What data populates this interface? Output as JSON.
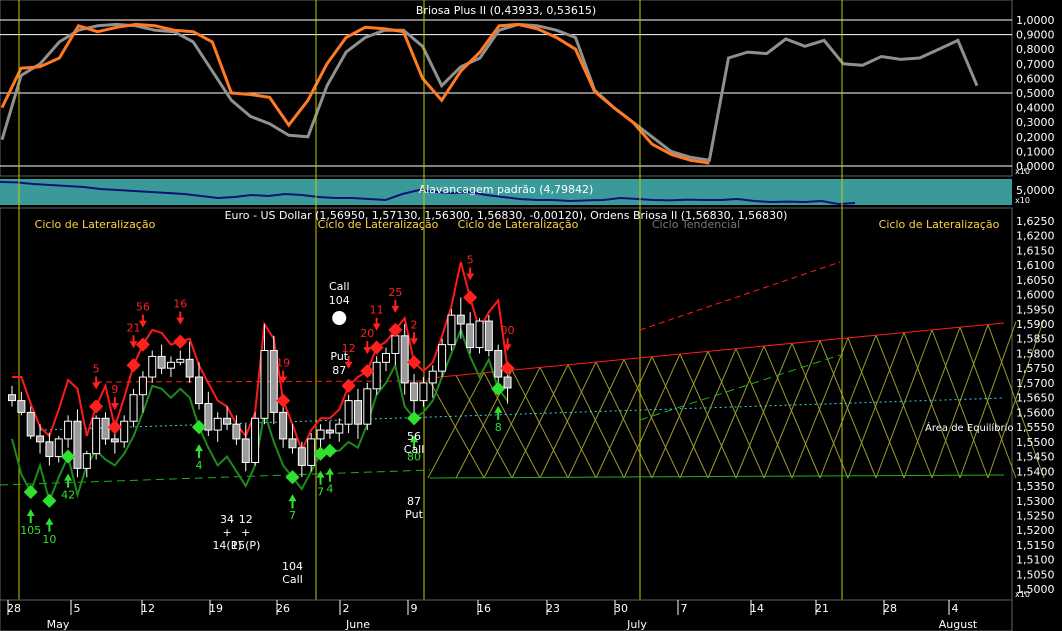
{
  "colors": {
    "background": "#000000",
    "grid": "#ffffff",
    "vline": "#c8c800",
    "band": "#3a9a9a",
    "red": "#ff1a1a",
    "green": "#1e8a1e",
    "orange": "#ff7a22",
    "gray": "#909090",
    "navy": "#10107a",
    "yellow_label": "#ffd24a",
    "cyan": "#30d8e8",
    "lattice": "#9a9a30"
  },
  "icons": {
    "stop_marker": "stop-sign-icon",
    "buy_arrow": "up-arrow-icon",
    "sell_arrow": "down-arrow-icon",
    "signal_diamond": "diamond-icon"
  },
  "panels": {
    "oscillator": {
      "title": "Briosa Plus II (0,43933, 0,53615)",
      "y_ticks": [
        "1,0000",
        "0,9000",
        "0,8000",
        "0,7000",
        "0,6000",
        "0,5000",
        "0,4000",
        "0,3000",
        "0,2000",
        "0,1000",
        "0,0000"
      ],
      "x10": "x10"
    },
    "leverage": {
      "title": "Alavancagem padrão (4,79842)",
      "y_ticks": [
        "5,0000"
      ],
      "x10": "x10"
    },
    "price": {
      "title": "Euro - US Dollar (1,56950, 1,57130, 1,56300, 1,56830, -0,00120), Ordens Briosa II (1,56830, 1,56830)",
      "y_ticks": [
        "1,6250",
        "1,6200",
        "1,6150",
        "1,6100",
        "1,6050",
        "1,6000",
        "1,5950",
        "1,5900",
        "1,5850",
        "1,5800",
        "1,5750",
        "1,5700",
        "1,5650",
        "1,5600",
        "1,5550",
        "1,5500",
        "1,5450",
        "1,5400",
        "1,5350",
        "1,5300",
        "1,5250",
        "1,5200",
        "1,5150",
        "1,5100",
        "1,5050",
        "1,5000"
      ],
      "x10": "x10",
      "cycle_labels": [
        "Ciclo de Lateralização",
        "Ciclo de Lateralização",
        "Ciclo de Lateralização",
        "Ciclo Tendencial",
        "Ciclo de Lateralização"
      ],
      "equilibrium_label": "Área de Equilíbrio"
    }
  },
  "x_axis": {
    "day_labels": [
      "28",
      "5",
      "12",
      "19",
      "26",
      "2",
      "9",
      "16",
      "23",
      "30",
      "7",
      "14",
      "21",
      "28",
      "4"
    ],
    "month_labels": [
      "May",
      "June",
      "July",
      "August"
    ]
  },
  "chart_data": {
    "type": "candlestick",
    "title": "Euro - US Dollar (1,56950, 1,57130, 1,56300, 1,56830, -0,00120), Ordens Briosa II (1,56830, 1,56830)",
    "ylim": [
      1.497,
      1.627
    ],
    "series": [
      {
        "name": "Briosa Plus II",
        "kind": "oscillator",
        "ylim": [
          0,
          1.05
        ],
        "values_gray": [
          0.18,
          0.62,
          0.7,
          0.85,
          0.93,
          0.96,
          0.97,
          0.96,
          0.93,
          0.92,
          0.85,
          0.65,
          0.45,
          0.34,
          0.29,
          0.21,
          0.2,
          0.55,
          0.78,
          0.88,
          0.93,
          0.93,
          0.82,
          0.55,
          0.68,
          0.74,
          0.93,
          0.97,
          0.96,
          0.93,
          0.88,
          0.52,
          0.4,
          0.3,
          0.2,
          0.1,
          0.06,
          0.04,
          0.74,
          0.78,
          0.77,
          0.87,
          0.82,
          0.86,
          0.7,
          0.69,
          0.75,
          0.73,
          0.74,
          0.8,
          0.86,
          0.55
        ],
        "values_orange": [
          0.4,
          0.67,
          0.68,
          0.74,
          0.96,
          0.92,
          0.95,
          0.97,
          0.96,
          0.93,
          0.92,
          0.85,
          0.5,
          0.49,
          0.47,
          0.28,
          0.45,
          0.7,
          0.88,
          0.95,
          0.94,
          0.92,
          0.6,
          0.45,
          0.65,
          0.78,
          0.96,
          0.97,
          0.94,
          0.88,
          0.8,
          0.51,
          0.4,
          0.3,
          0.15,
          0.08,
          0.04,
          0.02
        ]
      },
      {
        "name": "Alavancagem padrão",
        "kind": "leverage",
        "values": [
          4.8,
          4.78,
          4.7,
          4.65,
          4.6,
          4.55,
          4.45,
          4.4,
          4.35,
          4.3,
          4.25,
          4.2,
          4.1,
          4.0,
          4.05,
          4.15,
          4.1,
          4.2,
          4.15,
          4.05,
          4.0,
          4.0,
          3.95,
          3.9,
          4.2,
          4.4,
          4.3,
          4.25,
          4.3,
          4.15,
          4.05,
          3.95,
          3.9,
          3.9,
          3.85,
          3.88,
          3.9,
          4.0,
          3.95,
          3.9,
          3.88,
          3.92,
          3.9,
          3.9,
          3.95,
          3.85,
          3.8,
          3.82,
          3.8,
          3.85,
          3.7,
          3.75
        ]
      },
      {
        "name": "Euro - US Dollar",
        "candles": [
          [
            1.566,
            1.569,
            1.562,
            1.564
          ],
          [
            1.564,
            1.567,
            1.559,
            1.56
          ],
          [
            1.56,
            1.562,
            1.551,
            1.552
          ],
          [
            1.552,
            1.556,
            1.546,
            1.55
          ],
          [
            1.55,
            1.553,
            1.542,
            1.545
          ],
          [
            1.545,
            1.552,
            1.543,
            1.551
          ],
          [
            1.551,
            1.559,
            1.548,
            1.557
          ],
          [
            1.557,
            1.561,
            1.538,
            1.541
          ],
          [
            1.541,
            1.547,
            1.538,
            1.546
          ],
          [
            1.546,
            1.559,
            1.544,
            1.558
          ],
          [
            1.558,
            1.56,
            1.549,
            1.551
          ],
          [
            1.551,
            1.553,
            1.546,
            1.55
          ],
          [
            1.55,
            1.559,
            1.548,
            1.557
          ],
          [
            1.557,
            1.568,
            1.555,
            1.566
          ],
          [
            1.566,
            1.574,
            1.56,
            1.572
          ],
          [
            1.572,
            1.581,
            1.57,
            1.579
          ],
          [
            1.579,
            1.583,
            1.573,
            1.575
          ],
          [
            1.575,
            1.579,
            1.572,
            1.577
          ],
          [
            1.577,
            1.581,
            1.576,
            1.578
          ],
          [
            1.578,
            1.584,
            1.57,
            1.572
          ],
          [
            1.572,
            1.577,
            1.561,
            1.563
          ],
          [
            1.563,
            1.567,
            1.552,
            1.554
          ],
          [
            1.554,
            1.56,
            1.55,
            1.558
          ],
          [
            1.558,
            1.562,
            1.554,
            1.556
          ],
          [
            1.556,
            1.559,
            1.549,
            1.551
          ],
          [
            1.551,
            1.556,
            1.54,
            1.543
          ],
          [
            1.543,
            1.56,
            1.542,
            1.558
          ],
          [
            1.558,
            1.59,
            1.556,
            1.581
          ],
          [
            1.581,
            1.586,
            1.556,
            1.56
          ],
          [
            1.56,
            1.564,
            1.548,
            1.551
          ],
          [
            1.551,
            1.556,
            1.546,
            1.548
          ],
          [
            1.548,
            1.55,
            1.538,
            1.542
          ],
          [
            1.542,
            1.553,
            1.54,
            1.551
          ],
          [
            1.551,
            1.556,
            1.548,
            1.554
          ],
          [
            1.554,
            1.557,
            1.551,
            1.553
          ],
          [
            1.553,
            1.558,
            1.55,
            1.556
          ],
          [
            1.556,
            1.566,
            1.553,
            1.564
          ],
          [
            1.564,
            1.568,
            1.551,
            1.556
          ],
          [
            1.556,
            1.57,
            1.554,
            1.568
          ],
          [
            1.568,
            1.579,
            1.566,
            1.577
          ],
          [
            1.577,
            1.582,
            1.574,
            1.58
          ],
          [
            1.58,
            1.588,
            1.576,
            1.586
          ],
          [
            1.586,
            1.59,
            1.566,
            1.57
          ],
          [
            1.57,
            1.573,
            1.56,
            1.564
          ],
          [
            1.564,
            1.572,
            1.562,
            1.57
          ],
          [
            1.57,
            1.576,
            1.565,
            1.574
          ],
          [
            1.574,
            1.585,
            1.572,
            1.583
          ],
          [
            1.583,
            1.595,
            1.581,
            1.593
          ],
          [
            1.593,
            1.599,
            1.585,
            1.59
          ],
          [
            1.59,
            1.594,
            1.58,
            1.582
          ],
          [
            1.582,
            1.592,
            1.58,
            1.591
          ],
          [
            1.591,
            1.593,
            1.579,
            1.581
          ],
          [
            1.581,
            1.583,
            1.57,
            1.572
          ],
          [
            1.572,
            1.575,
            1.563,
            1.5683
          ]
        ],
        "upper_band_red": [
          1.572,
          1.572,
          1.563,
          1.555,
          1.552,
          1.561,
          1.571,
          1.568,
          1.552,
          1.562,
          1.569,
          1.555,
          1.565,
          1.576,
          1.583,
          1.588,
          1.587,
          1.583,
          1.584,
          1.585,
          1.576,
          1.57,
          1.564,
          1.562,
          1.556,
          1.552,
          1.56,
          1.59,
          1.585,
          1.564,
          1.556,
          1.547,
          1.554,
          1.558,
          1.558,
          1.561,
          1.569,
          1.572,
          1.574,
          1.582,
          1.584,
          1.588,
          1.592,
          1.577,
          1.574,
          1.577,
          1.586,
          1.596,
          1.611,
          1.599,
          1.588,
          1.594,
          1.598,
          1.575
        ],
        "lower_band_green": [
          1.551,
          1.539,
          1.533,
          1.542,
          1.53,
          1.538,
          1.545,
          1.532,
          1.542,
          1.547,
          1.544,
          1.542,
          1.546,
          1.552,
          1.56,
          1.569,
          1.568,
          1.565,
          1.568,
          1.565,
          1.555,
          1.548,
          1.542,
          1.545,
          1.54,
          1.535,
          1.542,
          1.56,
          1.55,
          1.542,
          1.538,
          1.534,
          1.54,
          1.546,
          1.547,
          1.547,
          1.55,
          1.548,
          1.556,
          1.566,
          1.57,
          1.576,
          1.562,
          1.558,
          1.56,
          1.564,
          1.572,
          1.58,
          1.588,
          1.579,
          1.572,
          1.578,
          1.568,
          1.564
        ],
        "signals": [
          {
            "i": 9,
            "label": "5",
            "dir": "sell"
          },
          {
            "i": 11,
            "label": "9",
            "dir": "sell"
          },
          {
            "i": 13,
            "label": "21",
            "dir": "sell"
          },
          {
            "i": 14,
            "label": "56",
            "dir": "sell"
          },
          {
            "i": 18,
            "label": "16",
            "dir": "sell"
          },
          {
            "i": 29,
            "label": "19",
            "dir": "sell"
          },
          {
            "i": 36,
            "label": "12",
            "dir": "sell"
          },
          {
            "i": 38,
            "label": "20",
            "dir": "sell"
          },
          {
            "i": 39,
            "label": "11",
            "dir": "sell"
          },
          {
            "i": 41,
            "label": "25",
            "dir": "sell"
          },
          {
            "i": 43,
            "label": "2",
            "dir": "sell"
          },
          {
            "i": 49,
            "label": "5",
            "dir": "sell"
          },
          {
            "i": 53,
            "label": "00",
            "dir": "sell"
          },
          {
            "i": 2,
            "label": "105",
            "dir": "buy"
          },
          {
            "i": 4,
            "label": "10",
            "dir": "buy"
          },
          {
            "i": 6,
            "label": "42",
            "dir": "buy"
          },
          {
            "i": 20,
            "label": "4",
            "dir": "buy"
          },
          {
            "i": 30,
            "label": "7",
            "dir": "buy"
          },
          {
            "i": 33,
            "label": "7",
            "dir": "buy"
          },
          {
            "i": 34,
            "label": "4",
            "dir": "buy"
          },
          {
            "i": 43,
            "label": "80",
            "dir": "buy"
          },
          {
            "i": 52,
            "label": "8",
            "dir": "buy"
          }
        ],
        "annotations": [
          {
            "text": "34",
            "i": 23,
            "sub": [
              "+",
              "14(P)"
            ]
          },
          {
            "text": "12",
            "i": 25,
            "sub": [
              "+",
              "15(P)"
            ]
          },
          {
            "text": "Call",
            "i": 35,
            "above": [
              "104"
            ]
          },
          {
            "text": "Put",
            "i": 35,
            "above": [
              "87"
            ]
          },
          {
            "text": "56",
            "i": 43,
            "sub": [
              "Call"
            ]
          },
          {
            "text": "87",
            "i": 43,
            "sub": [
              "Put"
            ]
          },
          {
            "text": "104",
            "i": 30,
            "sub": [
              "Call"
            ]
          }
        ]
      }
    ]
  }
}
